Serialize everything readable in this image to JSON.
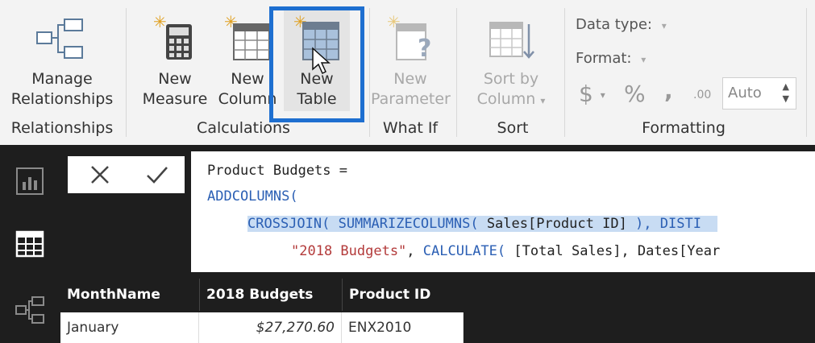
{
  "ribbon": {
    "manage_relationships": {
      "line1": "Manage",
      "line2": "Relationships"
    },
    "new_measure": {
      "line1": "New",
      "line2": "Measure"
    },
    "new_column": {
      "line1": "New",
      "line2": "Column"
    },
    "new_table": {
      "line1": "New",
      "line2": "Table"
    },
    "new_parameter": {
      "line1": "New",
      "line2": "Parameter"
    },
    "sort_by_column": {
      "line1": "Sort by",
      "line2": "Column"
    },
    "groups": {
      "relationships": "Relationships",
      "calculations": "Calculations",
      "what_if": "What If",
      "sort": "Sort",
      "formatting": "Formatting"
    },
    "formatting": {
      "data_type_label": "Data type:",
      "format_label": "Format:",
      "currency_symbol": "$",
      "percent_symbol": "%",
      "comma_symbol": ",",
      "decimal_symbol": ".00",
      "auto_value": "Auto"
    }
  },
  "formula": {
    "line1": "Product Budgets =",
    "line2": "ADDCOLUMNS(",
    "line3_a": "CROSSJOIN( SUMMARIZECOLUMNS( ",
    "line3_b": "Sales[Product ID]",
    "line3_c": " ), DISTI",
    "line4_a": "\"2018 Budgets\"",
    "line4_b": ", ",
    "line4_c": "CALCULATE(",
    "line4_d": " [Total Sales], Dates[Year"
  },
  "table": {
    "columns": [
      "MonthName",
      "2018 Budgets",
      "Product ID"
    ],
    "rows": [
      [
        "January",
        "$27,270.60",
        "ENX2010"
      ]
    ]
  },
  "colors": {
    "highlight": "#1e6fd0",
    "keyword": "#2b5fb4",
    "string": "#b33a3a",
    "selection": "#c8dcf3"
  }
}
